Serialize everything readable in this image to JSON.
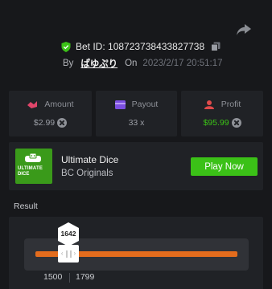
{
  "header": {
    "bet_id": "Bet ID: 108723738433827738",
    "by_label": "By",
    "username": "ぱゆぷり",
    "on_label": "On",
    "datetime": "2023/2/17 20:51:17"
  },
  "stats": {
    "amount": {
      "label": "Amount",
      "value": "$2.99",
      "icon": "amount-icon"
    },
    "payout": {
      "label": "Payout",
      "value": "33 x",
      "icon": "payout-icon"
    },
    "profit": {
      "label": "Profit",
      "value": "$95.99",
      "icon": "profit-icon"
    }
  },
  "game": {
    "thumb_line1": "ULTIMATE",
    "thumb_line2": "DICE",
    "title": "Ultimate Dice",
    "provider": "BC Originals",
    "play_label": "Play Now"
  },
  "result": {
    "label": "Result",
    "roll": "1642",
    "range_low": "1500",
    "range_high": "1799"
  },
  "colors": {
    "background": "#17181b",
    "card": "#202226",
    "accent_green": "#3bc117",
    "track_orange": "#e36c1d",
    "amount_icon": "#e0456a",
    "payout_icon": "#7c4fe0",
    "profit_icon": "#e04a4a"
  }
}
